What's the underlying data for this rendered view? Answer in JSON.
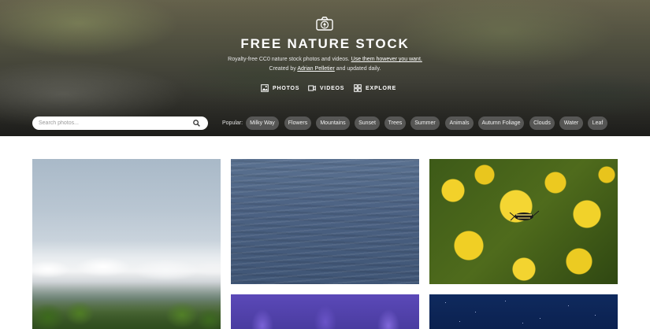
{
  "site": {
    "title": "FREE NATURE STOCK",
    "tagline_part1": "Royalty-free CC0 nature stock photos and videos. ",
    "tagline_link1": "Use them however you want.",
    "tagline_part2": "Created by ",
    "tagline_link2": "Adrian Pelletier",
    "tagline_part3": " and updated daily.",
    "logo_icon": "camera-tree-icon"
  },
  "nav": {
    "photos": "PHOTOS",
    "videos": "VIDEOS",
    "explore": "EXPLORE"
  },
  "search": {
    "placeholder": "Search photos...",
    "value": ""
  },
  "popular": {
    "label": "Popular:",
    "tags": [
      "Milky Way",
      "Flowers",
      "Mountains",
      "Sunset",
      "Trees",
      "Summer",
      "Animals",
      "Autumn Foliage",
      "Clouds",
      "Water",
      "Leaf"
    ]
  },
  "photos": [
    {
      "subject": "clouds-over-forest"
    },
    {
      "subject": "ocean-water"
    },
    {
      "subject": "beetle-on-yellow-flowers"
    },
    {
      "subject": "lavender"
    },
    {
      "subject": "starry-night-sky"
    }
  ],
  "colors": {
    "header_text": "#ffffff",
    "tag_background": "#787878",
    "page_background": "#ffffff"
  }
}
